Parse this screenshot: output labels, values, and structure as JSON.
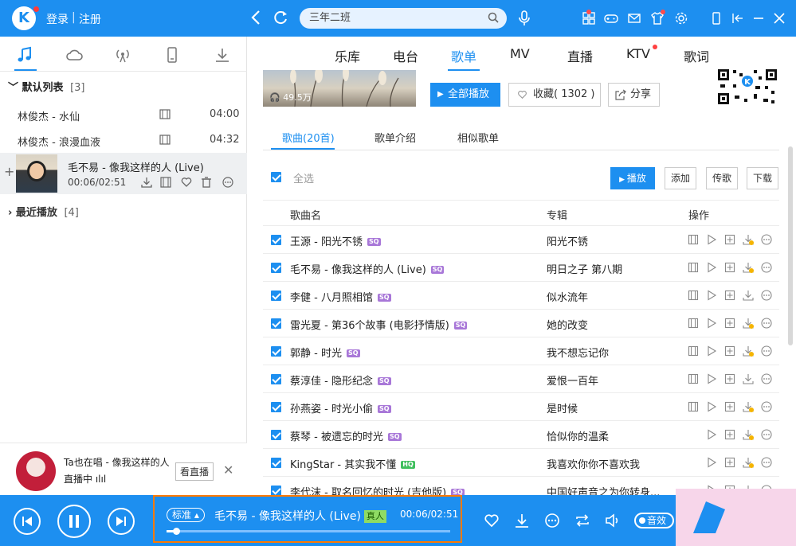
{
  "header": {
    "logo_text": "K",
    "login": "登录",
    "separator": "|",
    "register": "注册",
    "search_value": "三年二班"
  },
  "sidebar": {
    "default_list": {
      "label": "默认列表",
      "count": "[3]"
    },
    "songs": [
      {
        "title": "林俊杰 - 水仙",
        "duration": "04:00"
      },
      {
        "title": "林俊杰 - 浪漫血液",
        "duration": "04:32"
      }
    ],
    "playing": {
      "title": "毛不易 - 像我这样的人 (Live)",
      "time": "00:06/02:51"
    },
    "recent": {
      "label": "最近播放",
      "count": "[4]"
    },
    "live": {
      "line1": "Ta也在唱 - 像我这样的人",
      "line2": "直播中 ılıl",
      "watch": "看直播"
    }
  },
  "categories": [
    "乐库",
    "电台",
    "歌单",
    "MV",
    "直播",
    "KTV",
    "歌词"
  ],
  "playlist": {
    "play_count": "49.5万",
    "play_all": "全部播放",
    "collect": "收藏( 1302 )",
    "share": "分享"
  },
  "subtabs": [
    "歌曲(20首)",
    "歌单介绍",
    "相似歌单"
  ],
  "actions": {
    "select_all": "全选",
    "play": "播放",
    "add": "添加",
    "send": "传歌",
    "download": "下载"
  },
  "table": {
    "headers": [
      "歌曲名",
      "专辑",
      "操作"
    ],
    "rows": [
      {
        "name": "王源 - 阳光不锈",
        "q": "SQ",
        "album": "阳光不锈"
      },
      {
        "name": "毛不易 - 像我这样的人 (Live)",
        "q": "SQ",
        "album": "明日之子 第八期"
      },
      {
        "name": "李健 - 八月照相馆",
        "q": "SQ",
        "album": "似水流年"
      },
      {
        "name": "雷光夏 - 第36个故事 (电影抒情版)",
        "q": "SQ",
        "album": "她的改变"
      },
      {
        "name": "郭静 - 时光",
        "q": "SQ",
        "album": "我不想忘记你"
      },
      {
        "name": "蔡淳佳 - 隐形纪念",
        "q": "SQ",
        "album": "爱恨一百年"
      },
      {
        "name": "孙燕姿 - 时光小偷",
        "q": "SQ",
        "album": "是时候"
      },
      {
        "name": "蔡琴 - 被遗忘的时光",
        "q": "SQ",
        "album": "恰似你的温柔"
      },
      {
        "name": "KingStar - 其实我不懂",
        "q": "HQ",
        "album": "我喜欢你你不喜欢我"
      },
      {
        "name": "李代沫 - 取名回忆的时光 (吉他版)",
        "q": "SQ",
        "album": "中国好声音之为你转身..."
      }
    ]
  },
  "player": {
    "quality": "标准",
    "title": "毛不易 - 像我这样的人 (Live)",
    "tag": "真人",
    "time": "00:06/02:51",
    "progress": 0.035,
    "sound_label": "音效"
  },
  "colors": {
    "accent": "#1d8ff0",
    "highlight": "#ff7a00"
  }
}
